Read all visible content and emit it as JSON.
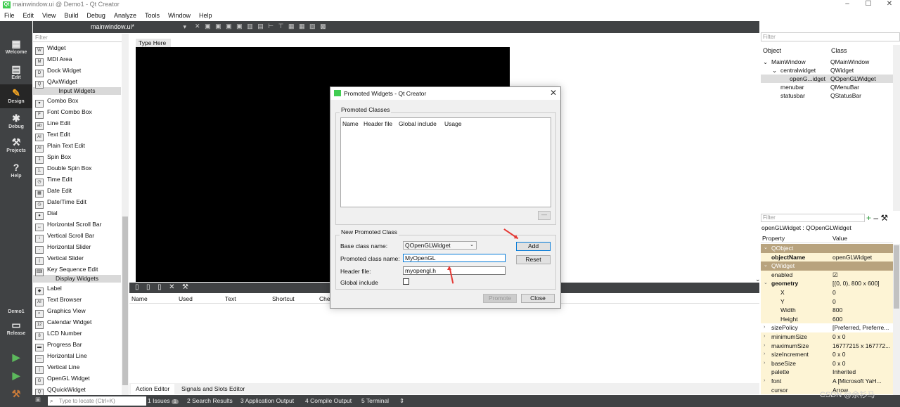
{
  "window": {
    "title": "mainwindow.ui @ Demo1 - Qt Creator",
    "app_icon_text": "Qt"
  },
  "menu": [
    "File",
    "Edit",
    "View",
    "Build",
    "Debug",
    "Analyze",
    "Tools",
    "Window",
    "Help"
  ],
  "modes": [
    {
      "label": "Welcome",
      "icon": "grid-icon"
    },
    {
      "label": "Edit",
      "icon": "document-icon"
    },
    {
      "label": "Design",
      "icon": "pencil-icon"
    },
    {
      "label": "Debug",
      "icon": "bug-icon"
    },
    {
      "label": "Projects",
      "icon": "wrench-icon"
    },
    {
      "label": "Help",
      "icon": "help-icon"
    }
  ],
  "kit": {
    "project": "Demo1",
    "config": "Release"
  },
  "doc_tab": "mainwindow.ui*",
  "widget_box": {
    "filter_placeholder": "Filter",
    "sections": [
      {
        "type": "item",
        "label": "Widget",
        "icon": "W"
      },
      {
        "type": "item",
        "label": "MDI Area",
        "icon": "M"
      },
      {
        "type": "item",
        "label": "Dock Widget",
        "icon": "D"
      },
      {
        "type": "item",
        "label": "QAxWidget",
        "icon": "Q"
      },
      {
        "type": "category",
        "label": "Input Widgets"
      },
      {
        "type": "item",
        "label": "Combo Box",
        "icon": "▾"
      },
      {
        "type": "item",
        "label": "Font Combo Box",
        "icon": "F"
      },
      {
        "type": "item",
        "label": "Line Edit",
        "icon": "ab"
      },
      {
        "type": "item",
        "label": "Text Edit",
        "icon": "AI"
      },
      {
        "type": "item",
        "label": "Plain Text Edit",
        "icon": "AI"
      },
      {
        "type": "item",
        "label": "Spin Box",
        "icon": "1"
      },
      {
        "type": "item",
        "label": "Double Spin Box",
        "icon": "1."
      },
      {
        "type": "item",
        "label": "Time Edit",
        "icon": "◷"
      },
      {
        "type": "item",
        "label": "Date Edit",
        "icon": "▦"
      },
      {
        "type": "item",
        "label": "Date/Time Edit",
        "icon": "◷"
      },
      {
        "type": "item",
        "label": "Dial",
        "icon": "●"
      },
      {
        "type": "item",
        "label": "Horizontal Scroll Bar",
        "icon": "↔"
      },
      {
        "type": "item",
        "label": "Vertical Scroll Bar",
        "icon": "↕"
      },
      {
        "type": "item",
        "label": "Horizontal Slider",
        "icon": "-"
      },
      {
        "type": "item",
        "label": "Vertical Slider",
        "icon": "|"
      },
      {
        "type": "item",
        "label": "Key Sequence Edit",
        "icon": "⌨"
      },
      {
        "type": "category",
        "label": "Display Widgets"
      },
      {
        "type": "item",
        "label": "Label",
        "icon": "◆"
      },
      {
        "type": "item",
        "label": "Text Browser",
        "icon": "AI"
      },
      {
        "type": "item",
        "label": "Graphics View",
        "icon": "◐"
      },
      {
        "type": "item",
        "label": "Calendar Widget",
        "icon": "12"
      },
      {
        "type": "item",
        "label": "LCD Number",
        "icon": "8"
      },
      {
        "type": "item",
        "label": "Progress Bar",
        "icon": "▬"
      },
      {
        "type": "item",
        "label": "Horizontal Line",
        "icon": "—"
      },
      {
        "type": "item",
        "label": "Vertical Line",
        "icon": "|"
      },
      {
        "type": "item",
        "label": "OpenGL Widget",
        "icon": "G"
      },
      {
        "type": "item",
        "label": "QQuickWidget",
        "icon": "Q"
      }
    ]
  },
  "form": {
    "type_here": "Type Here"
  },
  "action_editor": {
    "columns": [
      "Name",
      "Used",
      "Text",
      "Shortcut",
      "Che"
    ],
    "tabs": [
      "Action Editor",
      "Signals and Slots Editor"
    ]
  },
  "object_inspector": {
    "filter_placeholder": "Filter",
    "headers": [
      "Object",
      "Class"
    ],
    "rows": [
      {
        "object": "MainWindow",
        "class": "QMainWindow",
        "indent": 0,
        "arrow": "⌄"
      },
      {
        "object": "centralwidget",
        "class": "QWidget",
        "indent": 1,
        "arrow": "⌄"
      },
      {
        "object": "openG...idget",
        "class": "QOpenGLWidget",
        "indent": 2,
        "arrow": ""
      },
      {
        "object": "menubar",
        "class": "QMenuBar",
        "indent": 1,
        "arrow": ""
      },
      {
        "object": "statusbar",
        "class": "QStatusBar",
        "indent": 1,
        "arrow": ""
      }
    ]
  },
  "property_editor": {
    "filter_placeholder": "Filter",
    "subtitle": "openGLWidget : QOpenGLWidget",
    "headers": [
      "Property",
      "Value"
    ],
    "rows": [
      {
        "kind": "section",
        "name": "QObject"
      },
      {
        "kind": "prop",
        "name": "objectName",
        "value": "openGLWidget",
        "bold": true,
        "style": "yel"
      },
      {
        "kind": "section",
        "name": "QWidget"
      },
      {
        "kind": "prop",
        "name": "enabled",
        "value": "☑",
        "style": "yel"
      },
      {
        "kind": "prop",
        "name": "geometry",
        "value": "[(0, 0), 800 x 600]",
        "bold": true,
        "style": "yel",
        "arrow": "⌄"
      },
      {
        "kind": "sub",
        "name": "X",
        "value": "0",
        "style": "yel"
      },
      {
        "kind": "sub",
        "name": "Y",
        "value": "0",
        "style": "yel"
      },
      {
        "kind": "sub",
        "name": "Width",
        "value": "800",
        "style": "yel"
      },
      {
        "kind": "sub",
        "name": "Height",
        "value": "600",
        "style": "yel"
      },
      {
        "kind": "prop",
        "name": "sizePolicy",
        "value": "[Preferred, Preferre...",
        "style": "",
        "arrow": "›"
      },
      {
        "kind": "prop",
        "name": "minimumSize",
        "value": "0 x 0",
        "style": "yel",
        "arrow": "›"
      },
      {
        "kind": "prop",
        "name": "maximumSize",
        "value": "16777215 x 167772...",
        "style": "yel",
        "arrow": "›"
      },
      {
        "kind": "prop",
        "name": "sizeIncrement",
        "value": "0 x 0",
        "style": "yel",
        "arrow": "›"
      },
      {
        "kind": "prop",
        "name": "baseSize",
        "value": "0 x 0",
        "style": "yel",
        "arrow": "›"
      },
      {
        "kind": "prop",
        "name": "palette",
        "value": "Inherited",
        "style": "yel"
      },
      {
        "kind": "prop",
        "name": "font",
        "value": "A  [Microsoft YaH...",
        "style": "yel",
        "arrow": "›"
      },
      {
        "kind": "prop",
        "name": "cursor",
        "value": "Arrow",
        "style": "yel"
      }
    ]
  },
  "statusbar": {
    "locator_placeholder": "Type to locate (Ctrl+K)",
    "items": [
      "1  Issues",
      "2  Search Results",
      "3  Application Output",
      "4  Compile Output",
      "5  Terminal"
    ],
    "issues_badge": "1"
  },
  "dialog": {
    "title": "Promoted Widgets - Qt Creator",
    "promoted_classes_group": "Promoted Classes",
    "table_headers": [
      "Name",
      "Header file",
      "Global include",
      "Usage"
    ],
    "minus_label": "—",
    "new_group": "New Promoted Class",
    "base_class_label": "Base class name:",
    "base_class_value": "QOpenGLWidget",
    "promoted_name_label": "Promoted class name:",
    "promoted_name_value": "MyOpenGL",
    "header_file_label": "Header file:",
    "header_file_value": "myopengl.h",
    "global_include_label": "Global include",
    "add": "Add",
    "reset": "Reset",
    "promote": "Promote",
    "close": "Close"
  },
  "watermark": "CSDN @余衫马",
  "colors": {
    "sidebar": "#404244",
    "accent": "#0078d7",
    "arrow": "#e53935",
    "property_yellow": "#fdf4d5",
    "section": "#b8a37e"
  }
}
